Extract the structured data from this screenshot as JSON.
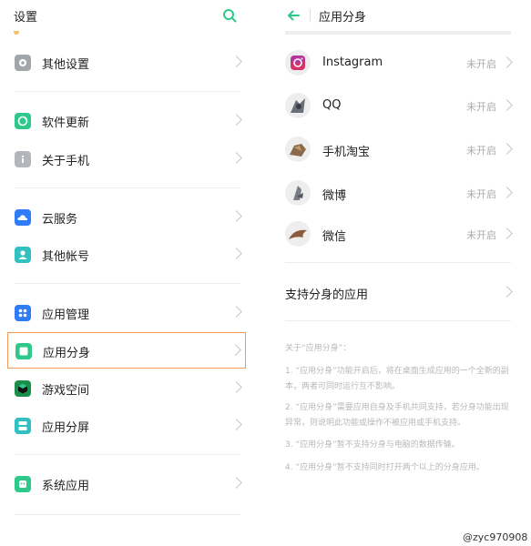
{
  "left": {
    "title": "设置",
    "items": [
      {
        "label": "其他设置",
        "icon": "settings-icon",
        "color": "#9aa0a6"
      },
      {
        "label": "软件更新",
        "icon": "update-icon",
        "color": "#2ec98a"
      },
      {
        "label": "关于手机",
        "icon": "info-icon",
        "color": "#b0b4b8"
      },
      {
        "label": "云服务",
        "icon": "cloud-icon",
        "color": "#2f7cf6"
      },
      {
        "label": "其他帐号",
        "icon": "account-icon",
        "color": "#33c0c0"
      },
      {
        "label": "应用管理",
        "icon": "app-grid-icon",
        "color": "#2f7cf6"
      },
      {
        "label": "应用分身",
        "icon": "app-clone-icon",
        "color": "#2ec98a"
      },
      {
        "label": "游戏空间",
        "icon": "game-cube-icon",
        "color": "#1fa35a"
      },
      {
        "label": "应用分屏",
        "icon": "split-screen-icon",
        "color": "#33c0c0"
      },
      {
        "label": "系统应用",
        "icon": "system-app-icon",
        "color": "#2ec98a"
      }
    ]
  },
  "right": {
    "title": "应用分身",
    "apps": [
      {
        "label": "Instagram",
        "status": "未开启",
        "icon": "instagram-icon"
      },
      {
        "label": "QQ",
        "status": "未开启",
        "icon": "qq-icon"
      },
      {
        "label": "手机淘宝",
        "status": "未开启",
        "icon": "taobao-icon"
      },
      {
        "label": "微博",
        "status": "未开启",
        "icon": "weibo-icon"
      },
      {
        "label": "微信",
        "status": "未开启",
        "icon": "wechat-icon"
      }
    ],
    "support_label": "支持分身的应用",
    "about_title": "关于“应用分身”：",
    "notes": [
      "1. “应用分身”功能开启后，将在桌面生成应用的一个全新的副本，两者可同时运行互不影响。",
      "2. “应用分身”需要应用自身及手机共同支持，若分身功能出现异常，则说明此功能或操作不被应用或手机支持。",
      "3. “应用分身”暂不支持分身与电脑的数据传输。",
      "4. “应用分身”暂不支持同时打开两个以上的分身应用。"
    ]
  },
  "watermark": "@zyc970908",
  "colors": {
    "accent": "#2ec98a",
    "highlight": "#f39a5b"
  }
}
